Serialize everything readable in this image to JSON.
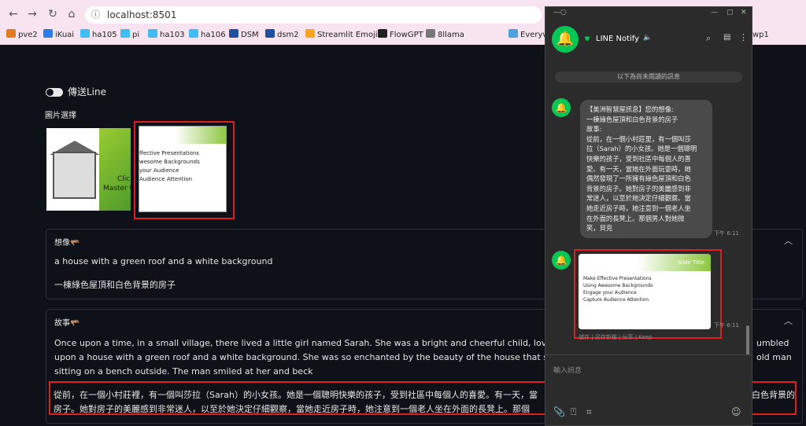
{
  "browser": {
    "url": "localhost:8501",
    "bookmarks": [
      "pve2",
      "iKuai",
      "ha105",
      "pi",
      "ha103",
      "ha106",
      "DSM",
      "dsm2",
      "Streamlit Emojis",
      "FlowGPT",
      "8llama",
      "Everywh",
      "wp1"
    ]
  },
  "app": {
    "toggle_label": "傳送Line",
    "image_select_label": "圖片選擇",
    "thumb1_text": "Click",
    "thumb1_text2": "Master ti",
    "thumb2_lines": [
      "ffective Presentations",
      "wesome Backgrounds",
      "your Audience",
      "Audience Attention"
    ],
    "imagine": {
      "header": "想像🫳🏽",
      "en": "a house with a green roof and a white background",
      "zh": "一棟綠色屋頂和白色背景的房子"
    },
    "story": {
      "header": "故事🫳🏽",
      "en_line1": "Once upon a time, in a small village, there lived a little girl named Sarah. She was a bright and cheerful child, loved by everyone in the",
      "en_line1_tail": "umbled",
      "en_line2": "upon a house with a green roof and a white background. She was so enchanted by the beauty of the house that she decided to take a",
      "en_line2_tail": "old man",
      "en_line3": "sitting on a bench outside. The man smiled at her and beck",
      "zh_line1": "從前，在一個小村莊裡，有一個叫莎拉（Sarah）的小女孩。她是一個聰明快樂的孩子，受到社區中每個人的喜愛。有一天，當",
      "zh_line1_tail": "白色背景的",
      "zh_line2": "房子。她對房子的美麗感到非常迷人，以至於她決定仔細觀察，當她走近房子時，她注意到一個老人坐在外面的長凳上。那個"
    }
  },
  "line": {
    "title": "LINE Notify",
    "unread": "以下為尚未閱讀的訊息",
    "message_lines": [
      "【美洲智慧屋訊息】您的想像:",
      "一棟綠色屋頂和白色背景的房子",
      "  故事:",
      "從前，在一個小村莊里，有一個叫莎",
      "拉（Sarah）的小女孩。她是一個聰明",
      "快樂的孩子，受到社區中每個人的喜",
      "愛。有一天，當她在外面玩耍時，她",
      "偶然發現了一所擁有綠色屋頂和白色",
      "背景的房子。她對房子的美麗感到非",
      "常迷人，以至於她決定仔細觀察。當",
      "她走近房子時，她注意到一個老人坐",
      "在外面的長凳上。那個男人對她微",
      "笑，貝克"
    ],
    "time1": "下午 6:11",
    "time2": "下午 6:11",
    "slide_title": "Slide Title",
    "slide_bullets": [
      "Make Effective Presentations",
      "Using Awesome Backgrounds",
      "Engage your Audience",
      "Capture Audience Attention"
    ],
    "actions": "儲存 | 另存新檔 | 分享 | Keep",
    "input_placeholder": "輸入訊息"
  }
}
